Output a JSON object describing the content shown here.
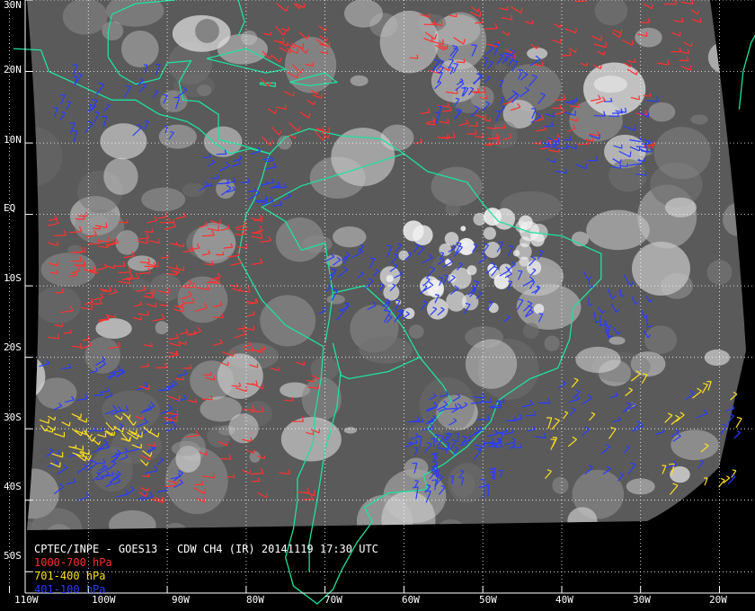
{
  "caption": {
    "title": "CPTEC/INPE - GOES13 - CDW CH4 (IR) 20141119 17:30 UTC",
    "legend": [
      {
        "label": "1000-700 hPa",
        "color": "#ff3030"
      },
      {
        "label": "701-400 hPa",
        "color": "#ffe020"
      },
      {
        "label": "401-100 hPa",
        "color": "#2a3cff"
      }
    ]
  },
  "axes": {
    "lat_labels": [
      "30N",
      "20N",
      "10N",
      "EQ",
      "10S",
      "20S",
      "30S",
      "40S",
      "50S"
    ],
    "lon_labels": [
      "110W",
      "100W",
      "90W",
      "80W",
      "70W",
      "60W",
      "50W",
      "40W",
      "30W",
      "20W"
    ],
    "lat_values": [
      30,
      20,
      10,
      0,
      -10,
      -20,
      -30,
      -40,
      -50
    ],
    "lon_values": [
      -110,
      -100,
      -90,
      -80,
      -70,
      -60,
      -50,
      -40,
      -30,
      -20
    ]
  },
  "map": {
    "extent": {
      "lon_min": -111.2,
      "lon_max": -15.5,
      "lat_max": 30.0,
      "lat_min": -55.5
    },
    "grid_color": "#ffffff",
    "coast_color": "#20e0a0",
    "background": "#000000",
    "image_gray": "#5a5a5a"
  }
}
